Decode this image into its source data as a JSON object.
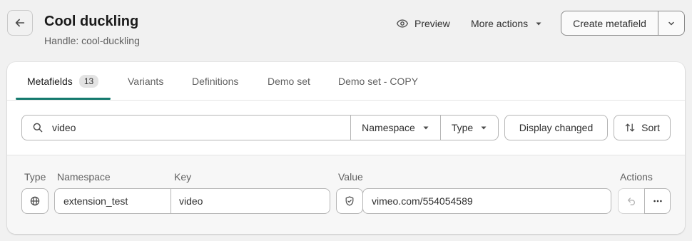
{
  "header": {
    "title": "Cool duckling",
    "subtitle": "Handle: cool-duckling",
    "back_icon": "arrow-left-icon",
    "preview_label": "Preview",
    "preview_icon": "eye-icon",
    "more_actions_label": "More actions",
    "create_label": "Create metafield"
  },
  "tabs": [
    {
      "label": "Metafields",
      "badge": "13",
      "active": true
    },
    {
      "label": "Variants"
    },
    {
      "label": "Definitions"
    },
    {
      "label": "Demo set"
    },
    {
      "label": "Demo set - COPY"
    }
  ],
  "filters": {
    "search_value": "video",
    "search_icon": "search-icon",
    "namespace_label": "Namespace",
    "type_label": "Type",
    "display_changed_label": "Display changed",
    "sort_label": "Sort"
  },
  "columns": {
    "type": "Type",
    "namespace": "Namespace",
    "key": "Key",
    "value": "Value",
    "actions": "Actions"
  },
  "row": {
    "type_icon": "globe-icon",
    "namespace": "extension_test",
    "key": "video",
    "value_icon": "shield-check-icon",
    "value": "vimeo.com/554054589"
  },
  "colors": {
    "accent": "#157a6e",
    "background": "#f1f1f1",
    "card": "#ffffff"
  }
}
